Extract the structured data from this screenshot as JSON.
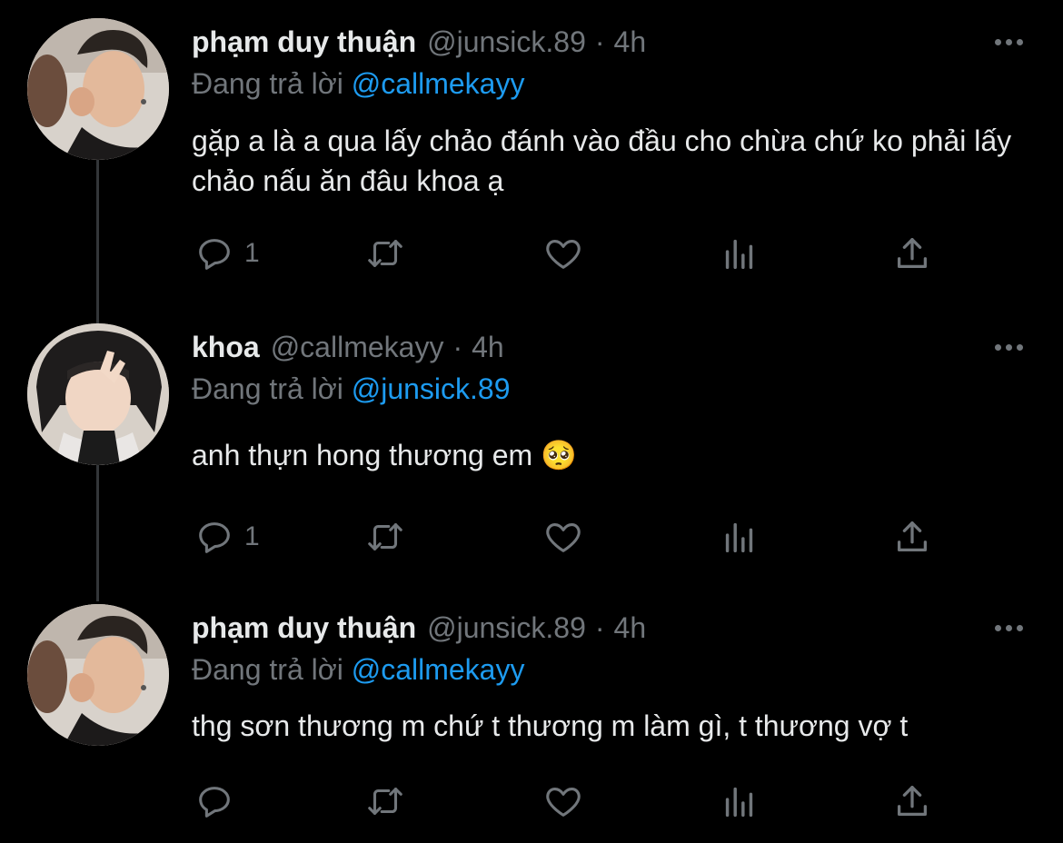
{
  "tweets": [
    {
      "display_name": "phạm duy thuận",
      "handle": "@junsick.89",
      "separator": "·",
      "time": "4h",
      "replying_prefix": "Đang trả lời",
      "replying_to": "@callmekayy",
      "text": "gặp a là a qua lấy chảo đánh vào đầu cho chừa chứ ko phải lấy chảo nấu ăn đâu khoa ạ",
      "reply_count": "1",
      "avatar": "avatar-photo-man"
    },
    {
      "display_name": "khoa",
      "handle": "@callmekayy",
      "separator": "·",
      "time": "4h",
      "replying_prefix": "Đang trả lời",
      "replying_to": "@junsick.89",
      "text": "anh thựn hong thương em 🥺",
      "reply_count": "1",
      "avatar": "avatar-photo-person-hat"
    },
    {
      "display_name": "phạm duy thuận",
      "handle": "@junsick.89",
      "separator": "·",
      "time": "4h",
      "replying_prefix": "Đang trả lời",
      "replying_to": "@callmekayy",
      "text": "thg sơn thương m chứ t thương m làm gì, t thương vợ t",
      "reply_count": "",
      "avatar": "avatar-photo-man"
    }
  ],
  "icons": {
    "reply": "speech-bubble-icon",
    "retweet": "retweet-arrows-icon",
    "like": "heart-icon",
    "stats": "bar-chart-icon",
    "share": "share-upload-icon",
    "more": "more-dots-icon"
  },
  "colors": {
    "background": "#000000",
    "text_primary": "#e7e9ea",
    "text_secondary": "#71767b",
    "accent_link": "#1d9bf0",
    "thread_line": "#333639"
  }
}
